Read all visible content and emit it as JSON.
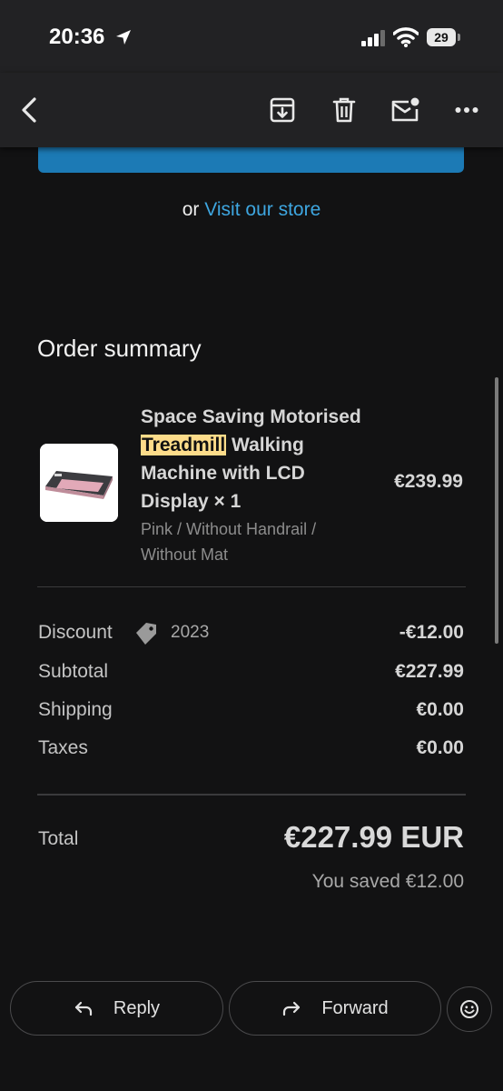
{
  "status_bar": {
    "time": "20:36",
    "battery": "29"
  },
  "toolbar": {
    "back": "back",
    "archive": "archive",
    "delete": "delete",
    "mark_unread": "mark-unread",
    "more": "more"
  },
  "store_link": {
    "prefix": "or",
    "link_text": "Visit our store"
  },
  "order_summary": {
    "title": "Order summary",
    "item": {
      "name_before": "Space Saving Motorised",
      "name_highlight": "Treadmill",
      "name_after": "Walking Machine with LCD Display × 1",
      "variant": "Pink / Without Handrail / Without Mat",
      "price": "€239.99"
    },
    "discount": {
      "label": "Discount",
      "code": "2023",
      "value": "-€12.00"
    },
    "subtotal": {
      "label": "Subtotal",
      "value": "€227.99"
    },
    "shipping": {
      "label": "Shipping",
      "value": "€0.00"
    },
    "taxes": {
      "label": "Taxes",
      "value": "€0.00"
    },
    "total": {
      "label": "Total",
      "value": "€227.99 EUR",
      "saved": "You saved €12.00"
    }
  },
  "actions": {
    "reply": "Reply",
    "forward": "Forward"
  },
  "colors": {
    "accent_button": "#1c7ab5",
    "link": "#3ea6e0",
    "highlight": "#fddc8a",
    "background": "#121213"
  }
}
